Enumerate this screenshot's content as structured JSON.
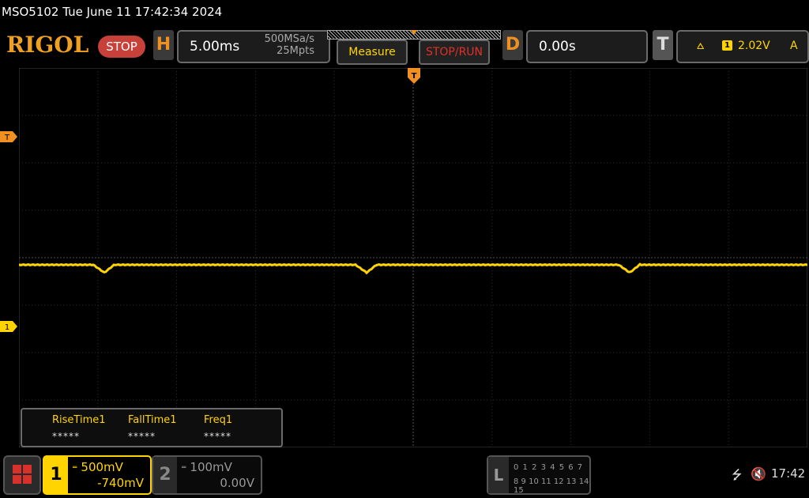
{
  "header": {
    "title": "MSO5102  Tue June 11 17:42:34 2024",
    "logo": "RIGOL",
    "run_state": "STOP"
  },
  "horizontal": {
    "letter": "H",
    "timebase": "5.00ms",
    "sample_rate": "500MSa/s",
    "memory_depth": "25Mpts"
  },
  "buttons": {
    "measure": "Measure",
    "stop_run": "STOP/RUN"
  },
  "delay": {
    "letter": "D",
    "value": "0.00s"
  },
  "trigger": {
    "letter": "T",
    "source": "1",
    "level": "2.02V",
    "mode": "A"
  },
  "markers": {
    "trigger_position": "T",
    "trigger_level": "T",
    "ch1_ground": "1"
  },
  "measurements": [
    {
      "name": "RiseTime1",
      "value": "*****"
    },
    {
      "name": "FallTime1",
      "value": "*****"
    },
    {
      "name": "Freq1",
      "value": "*****"
    }
  ],
  "channels": [
    {
      "number": "1",
      "scale": "500mV",
      "offset": "-740mV",
      "active": true,
      "color": "#ffd400"
    },
    {
      "number": "2",
      "scale": "100mV",
      "offset": "0.00V",
      "active": false,
      "color": "#999999"
    }
  ],
  "logic": {
    "letter": "L",
    "row1": "0 1 2 3  4 5 6 7",
    "row2": "8 9 10 11 12 13 14 15"
  },
  "status": {
    "usb_icon": "usb-icon",
    "speaker_icon": "speaker-muted-icon",
    "time": "17:42"
  },
  "colors": {
    "ch1": "#ffd400",
    "brand": "#f0a020",
    "stop": "#c8403a"
  }
}
